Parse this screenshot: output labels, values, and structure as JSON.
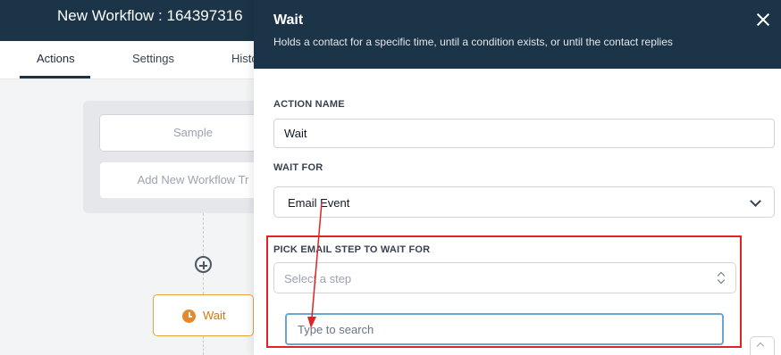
{
  "header": {
    "title": "New Workflow : 164397316"
  },
  "tabs": [
    {
      "label": "Actions",
      "active": true
    },
    {
      "label": "Settings",
      "active": false
    },
    {
      "label": "Histo",
      "active": false
    }
  ],
  "canvas": {
    "trigger_sample": "Sample",
    "trigger_add": "Add New Workflow Tr",
    "wait_node_label": "Wait"
  },
  "drawer": {
    "title": "Wait",
    "subtitle": "Holds a contact for a specific time, until a condition exists, or until the contact replies",
    "action_name_label": "ACTION NAME",
    "action_name_value": "Wait",
    "wait_for_label": "WAIT FOR",
    "wait_for_value": "Email Event",
    "pick_step_label": "PICK EMAIL STEP TO WAIT FOR",
    "pick_step_placeholder": "Select a step",
    "search_placeholder": "Type to search"
  },
  "colors": {
    "header_bg": "#1b3447",
    "accent_orange": "#e5892c",
    "annotation_red": "#e02424",
    "focus_blue": "#6aa6cf"
  }
}
